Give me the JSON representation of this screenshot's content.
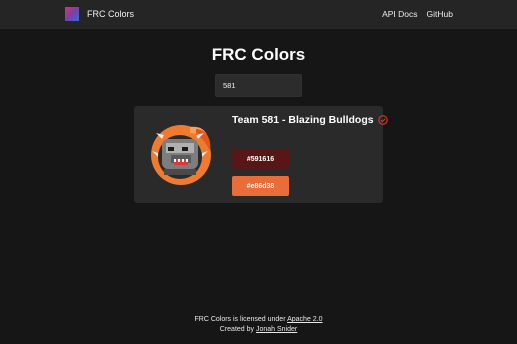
{
  "navbar": {
    "brand": "FRC Colors",
    "links": [
      "API Docs",
      "GitHub"
    ]
  },
  "main": {
    "title": "FRC Colors",
    "search_value": "581"
  },
  "team": {
    "name": "Team 581 - Blazing Bulldogs",
    "verified": true,
    "colors": {
      "primary": "#591616",
      "secondary": "#e86d38"
    },
    "primary_label": "#591616",
    "secondary_label": "#e86d38"
  },
  "footer": {
    "license_prefix": "FRC Colors is licensed under",
    "license_link": "Apache 2.0",
    "credit_prefix": "Created by",
    "credit_link": "Jonah Snider"
  },
  "theme": {
    "background": "#161616",
    "navbar": "#252525",
    "card": "#2a2a2a",
    "verified_icon": "#e0352b"
  }
}
